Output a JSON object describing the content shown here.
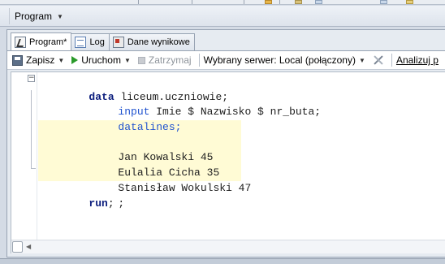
{
  "window": {
    "title": "Program"
  },
  "tabs": [
    {
      "label": "Program*",
      "active": true,
      "icon": "program-icon"
    },
    {
      "label": "Log",
      "active": false,
      "icon": "log-icon"
    },
    {
      "label": "Dane wynikowe",
      "active": false,
      "icon": "results-icon"
    }
  ],
  "toolbar": {
    "save": "Zapisz",
    "run": "Uruchom",
    "stop": "Zatrzymaj",
    "server": "Wybrany serwer: Local (połączony)",
    "analyze": "Analizuj p"
  },
  "code": {
    "l1_kw": "data",
    "l1_rest": " liceum.uczniowie;",
    "l2_kw": "input",
    "l2_rest": " Imie $ Nazwisko $ nr_buta;",
    "l3_kw": "datalines;",
    "l4": "Jan Kowalski 45",
    "l5": "Eulalia Cicha 35",
    "l6": "Stanisław Wokulski 47",
    "l7": ";",
    "l8_kw": "run",
    "l8_rest": ";"
  },
  "colors": {
    "keyword_data": "#0b1d7d",
    "keyword_statement": "#1f52cf",
    "datalines_highlight": "#fffbd5"
  }
}
